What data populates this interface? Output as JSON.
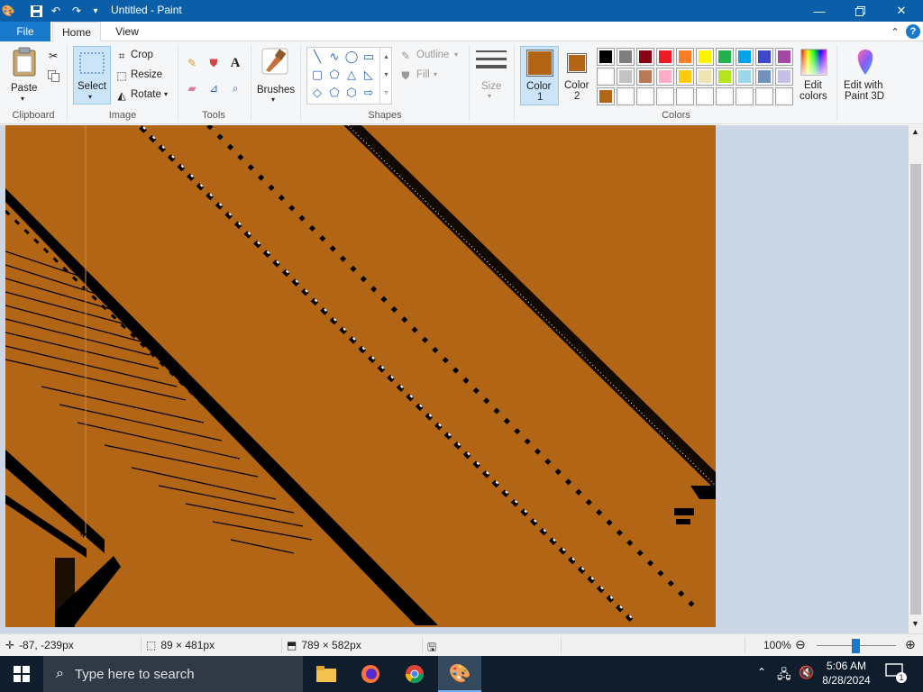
{
  "window": {
    "title": "Untitled - Paint"
  },
  "tabs": {
    "file": "File",
    "home": "Home",
    "view": "View"
  },
  "clipboard": {
    "paste": "Paste",
    "group": "Clipboard"
  },
  "image": {
    "select": "Select",
    "crop": "Crop",
    "resize": "Resize",
    "rotate": "Rotate",
    "group": "Image"
  },
  "tools": {
    "group": "Tools",
    "brushes": "Brushes"
  },
  "shapes": {
    "outline": "Outline",
    "fill": "Fill",
    "group": "Shapes"
  },
  "size": {
    "label": "Size"
  },
  "colors": {
    "color1_label": "Color",
    "color1_num": "1",
    "color2_label": "Color",
    "color2_num": "2",
    "color1_value": "#b26515",
    "color2_value": "#b26515",
    "edit_label_1": "Edit",
    "edit_label_2": "colors",
    "paint3d_label_1": "Edit with",
    "paint3d_label_2": "Paint 3D",
    "group": "Colors",
    "palette_row1": [
      "#000000",
      "#7f7f7f",
      "#880015",
      "#ed1c24",
      "#ff7f27",
      "#fff200",
      "#22b14c",
      "#00a2e8",
      "#3f48cc",
      "#a349a4"
    ],
    "palette_row2": [
      "#ffffff",
      "#c3c3c3",
      "#b97a57",
      "#ffaec9",
      "#ffc90e",
      "#efe4b0",
      "#b5e61d",
      "#99d9ea",
      "#7092be",
      "#c8bfe7"
    ],
    "palette_row3": [
      "#b26515",
      "#ffffff",
      "#ffffff",
      "#ffffff",
      "#ffffff",
      "#ffffff",
      "#ffffff",
      "#ffffff",
      "#ffffff",
      "#ffffff"
    ]
  },
  "canvas": {
    "background": "#b26515",
    "stroke": "#000000",
    "highlight": "#ffffff"
  },
  "status": {
    "cursor_pos": "-87, -239px",
    "selection_size": "89 × 481px",
    "image_size": "789 × 582px",
    "zoom": "100%"
  },
  "taskbar": {
    "search_placeholder": "Type here to search",
    "time": "5:06 AM",
    "date": "8/28/2024",
    "notification_count": "1"
  }
}
